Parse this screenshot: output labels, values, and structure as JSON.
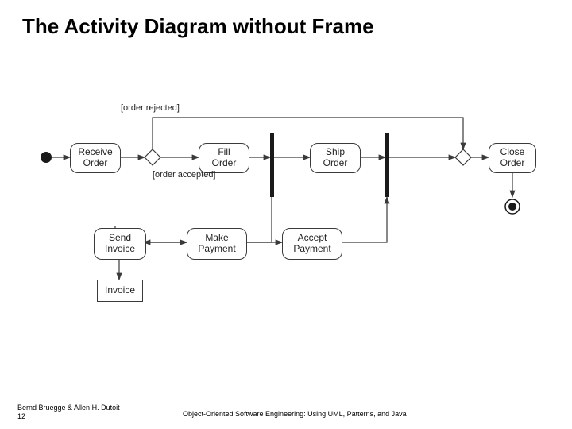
{
  "title": "The Activity Diagram without Frame",
  "footer_left_line1": "Bernd Bruegge & Allen H. Dutoit",
  "footer_left_line2": "12",
  "footer_mid": "Object-Oriented Software Engineering: Using UML, Patterns, and Java",
  "guards": {
    "rejected": "[order rejected]",
    "accepted": "[order accepted]"
  },
  "nodes": {
    "receive": "Receive\nOrder",
    "fill": "Fill\nOrder",
    "ship": "Ship\nOrder",
    "close": "Close\nOrder",
    "send_invoice": "Send\nInvoice",
    "make_payment": "Make\nPayment",
    "accept_payment": "Accept\nPayment",
    "invoice": "Invoice"
  }
}
